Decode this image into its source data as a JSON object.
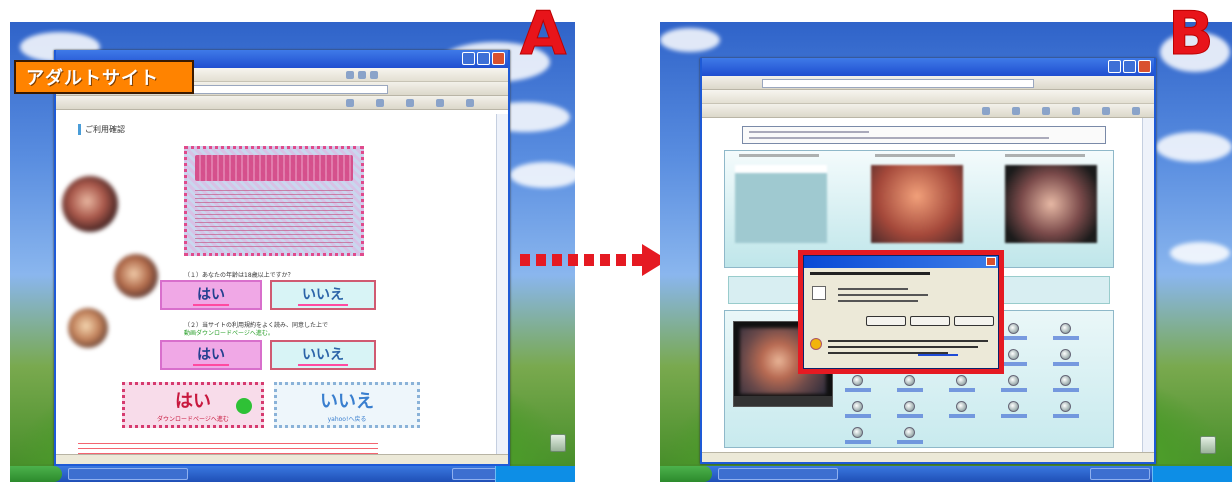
{
  "panels": {
    "a": {
      "label": "アダルトサイト",
      "letter": "A",
      "heading": "ご利用確認",
      "question1": "（１）あなたの年齢は18歳以上ですか？",
      "question2": "（２）当サイトの利用規約をよく読み、同意した上で",
      "question2_note": "動画ダウンロードページへ進む。",
      "yes_label": "はい",
      "no_label": "いいえ",
      "big_yes_label": "はい",
      "big_yes_sub": "ダウンロードページへ進む",
      "big_no_label": "いいえ",
      "big_no_sub": "yahoo!へ戻る"
    },
    "b": {
      "letter": "B"
    }
  },
  "colors": {
    "label_bg": "#ff8300",
    "letter": "#e8141a",
    "arrow": "#e51a22",
    "yes_bg": "#f0a8e6",
    "no_bg": "#d8f4f6"
  }
}
